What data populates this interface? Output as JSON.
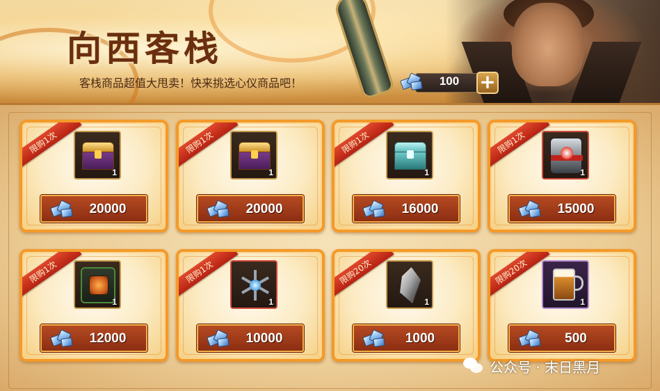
{
  "header": {
    "title": "向西客栈",
    "subtitle": "客栈商品超值大甩卖！快来挑选心仪商品吧！"
  },
  "currency": {
    "icon": "crystal-gem-icon",
    "amount": "100",
    "add_label": "+"
  },
  "shop": {
    "items": [
      {
        "limit": "限购1次",
        "icon": "gold-purple-chest-icon",
        "count": "1",
        "price": "20000"
      },
      {
        "limit": "限购1次",
        "icon": "gold-purple-chest-icon",
        "count": "1",
        "price": "20000"
      },
      {
        "limit": "限购1次",
        "icon": "teal-chest-icon",
        "count": "1",
        "price": "16000"
      },
      {
        "limit": "限购1次",
        "icon": "red-supply-crate-icon",
        "count": "1",
        "price": "15000"
      },
      {
        "limit": "限购1次",
        "icon": "mech-core-box-icon",
        "count": "1",
        "price": "12000"
      },
      {
        "limit": "限购1次",
        "icon": "tri-blade-spinner-icon",
        "count": "1",
        "price": "10000"
      },
      {
        "limit": "限购20次",
        "icon": "gray-crystal-icon",
        "count": "1",
        "price": "1000"
      },
      {
        "limit": "限购20次",
        "icon": "beer-mug-icon",
        "count": "1",
        "price": "500"
      }
    ]
  },
  "watermark": {
    "icon": "wechat-icon",
    "text": "公众号 · 末日黑月"
  },
  "colors": {
    "card_border": "#f39a2a",
    "ribbon": "#c52e18",
    "price_bar": "#a03a18",
    "title": "#6a2e10"
  }
}
